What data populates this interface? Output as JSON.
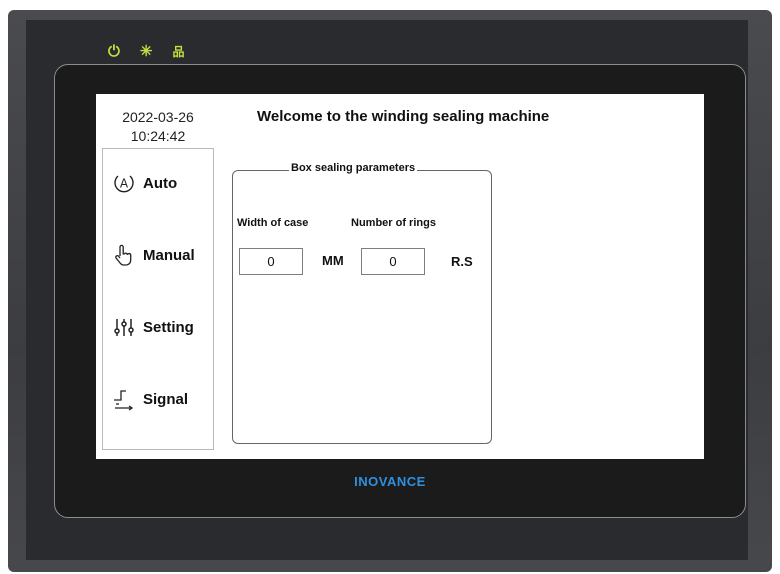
{
  "device": {
    "brand": "INOVANCE",
    "status_leds": [
      {
        "icon": "power-icon",
        "color": "#c6dc3f",
        "glyph": "⏻"
      },
      {
        "icon": "sun-icon",
        "color": "#c6dc3f",
        "glyph": "✳"
      },
      {
        "icon": "network-icon",
        "color": "#c6dc3f",
        "glyph": "品"
      }
    ]
  },
  "header": {
    "date": "2022-03-26",
    "time": "10:24:42",
    "title": "Welcome to the winding sealing machine"
  },
  "nav": {
    "items": [
      {
        "label": "Auto",
        "icon": "auto-mode-icon"
      },
      {
        "label": "Manual",
        "icon": "hand-pointer-icon"
      },
      {
        "label": "Setting",
        "icon": "sliders-icon"
      },
      {
        "label": "Signal",
        "icon": "signal-icon"
      }
    ]
  },
  "panel": {
    "title": "Box sealing parameters",
    "width_label": "Width of case",
    "width_value": "0",
    "width_unit": "MM",
    "rings_label": "Number of rings",
    "rings_value": "0",
    "rings_unit": "R.S"
  },
  "colors": {
    "led": "#c6dc3f",
    "brand": "#2f8fe0",
    "bezel": "#3c3d41",
    "screen_bg": "#ffffff"
  }
}
